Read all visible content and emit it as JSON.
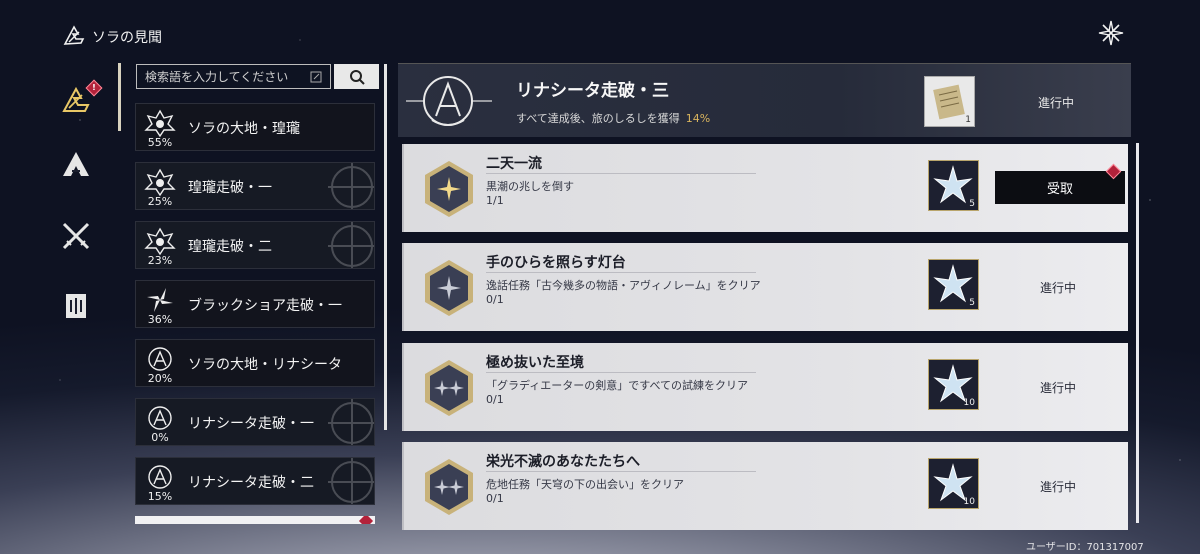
{
  "header": {
    "title": "ソラの見聞"
  },
  "search": {
    "placeholder": "検索語を入力してください"
  },
  "categories": [
    {
      "name": "ソラの大地・瑝瓏",
      "pct": "55%"
    },
    {
      "name": "瑝瓏走破・一",
      "pct": "25%"
    },
    {
      "name": "瑝瓏走破・二",
      "pct": "23%"
    },
    {
      "name": "ブラックショア走破・一",
      "pct": "36%"
    },
    {
      "name": "ソラの大地・リナシータ",
      "pct": "20%"
    },
    {
      "name": "リナシータ走破・一",
      "pct": "0%"
    },
    {
      "name": "リナシータ走破・二",
      "pct": "15%"
    }
  ],
  "main_header": {
    "title": "リナシータ走破・三",
    "desc": "すべて達成後、旅のしるしを獲得",
    "pct": "14%",
    "reward_qty": "1",
    "status": "進行中"
  },
  "achievements": [
    {
      "title": "二天一流",
      "desc": "黒潮の兆しを倒す",
      "progress": "1/1",
      "reward_qty": "5",
      "action": "受取"
    },
    {
      "title": "手のひらを照らす灯台",
      "desc": "逸話任務「古今幾多の物語・アヴィノレーム」をクリア",
      "progress": "0/1",
      "reward_qty": "5",
      "status": "進行中"
    },
    {
      "title": "極め抜いた至境",
      "desc": "「グラディエーターの剣意」ですべての試練をクリア",
      "progress": "0/1",
      "reward_qty": "10",
      "status": "進行中"
    },
    {
      "title": "栄光不滅のあなたたちへ",
      "desc": "危地任務「天穹の下の出会い」をクリア",
      "progress": "0/1",
      "reward_qty": "10",
      "status": "進行中"
    }
  ],
  "rail_badge": "!",
  "footer": {
    "user_id": "ユーザーID：701317007"
  }
}
